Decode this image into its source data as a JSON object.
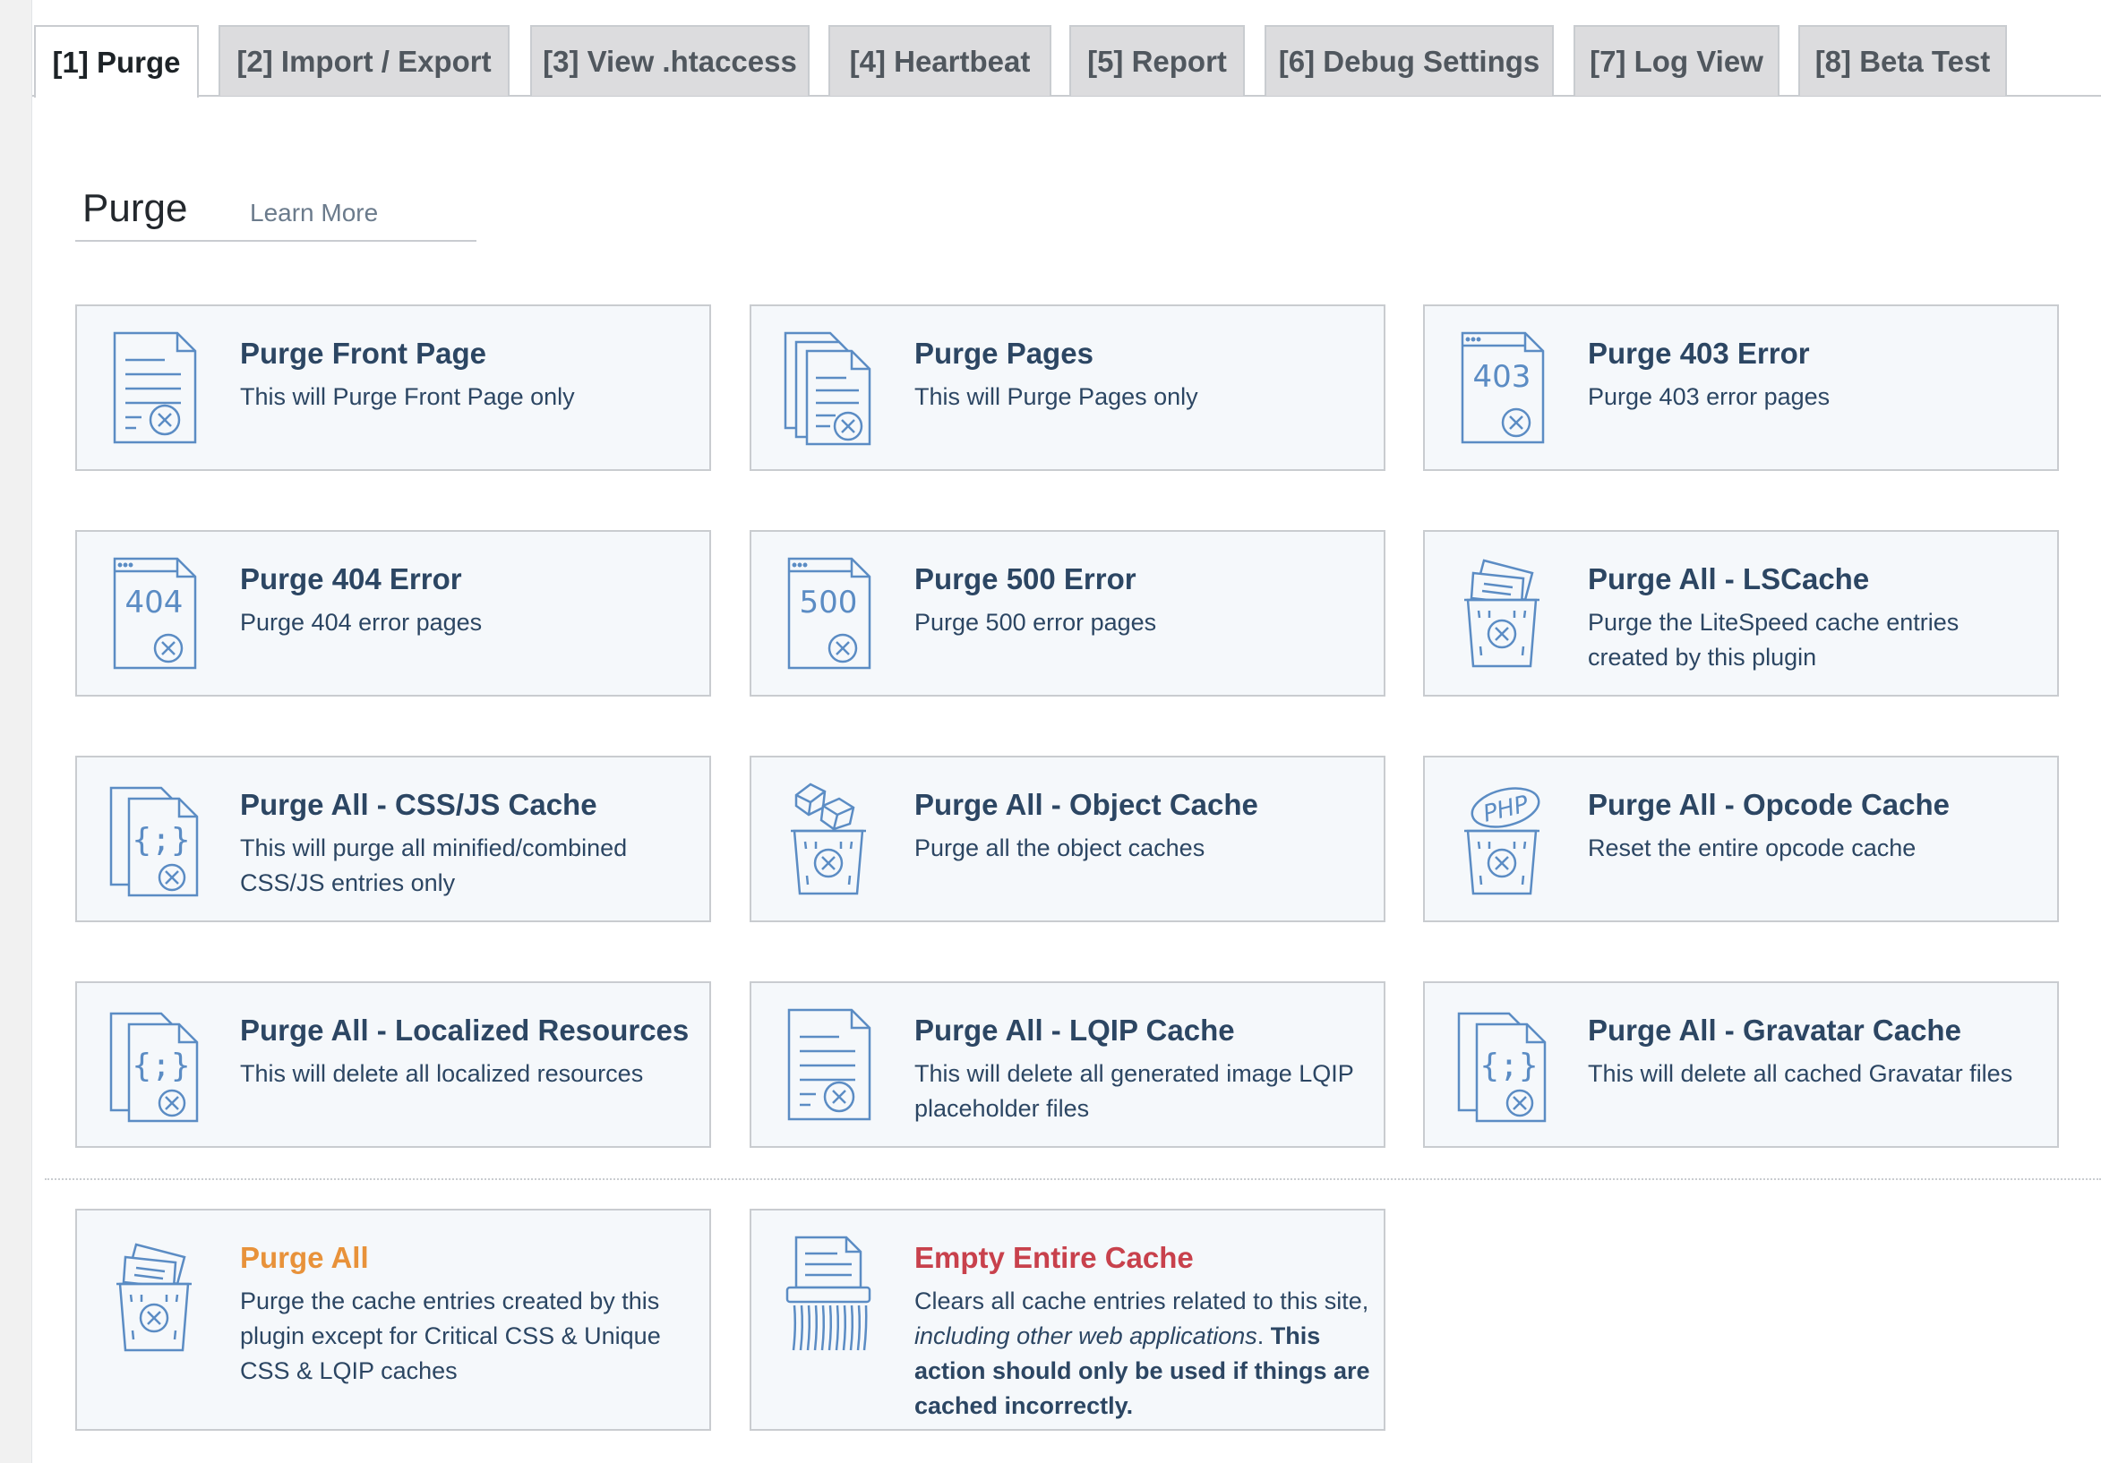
{
  "tabs": [
    {
      "label": "[1] Purge",
      "active": true
    },
    {
      "label": "[2] Import / Export",
      "active": false
    },
    {
      "label": "[3] View .htaccess",
      "active": false
    },
    {
      "label": "[4] Heartbeat",
      "active": false
    },
    {
      "label": "[5] Report",
      "active": false
    },
    {
      "label": "[6] Debug Settings",
      "active": false
    },
    {
      "label": "[7] Log View",
      "active": false
    },
    {
      "label": "[8] Beta Test",
      "active": false
    }
  ],
  "section": {
    "title": "Purge",
    "learn_more": "Learn More"
  },
  "cards": [
    {
      "title": "Purge Front Page",
      "desc": "This will Purge Front Page only",
      "icon": "document-purge-icon"
    },
    {
      "title": "Purge Pages",
      "desc": "This will Purge Pages only",
      "icon": "pages-purge-icon"
    },
    {
      "title": "Purge 403 Error",
      "desc": "Purge 403 error pages",
      "icon": "error-403-icon",
      "code": "403"
    },
    {
      "title": "Purge 404 Error",
      "desc": "Purge 404 error pages",
      "icon": "error-404-icon",
      "code": "404"
    },
    {
      "title": "Purge 500 Error",
      "desc": "Purge 500 error pages",
      "icon": "error-500-icon",
      "code": "500"
    },
    {
      "title": "Purge All - LSCache",
      "desc": "Purge the LiteSpeed cache entries created by this plugin",
      "icon": "trash-pages-icon"
    },
    {
      "title": "Purge All - CSS/JS Cache",
      "desc": "This will purge all minified/combined CSS/JS entries only",
      "icon": "code-files-icon"
    },
    {
      "title": "Purge All - Object Cache",
      "desc": "Purge all the object caches",
      "icon": "trash-cubes-icon"
    },
    {
      "title": "Purge All - Opcode Cache",
      "desc": "Reset the entire opcode cache",
      "icon": "trash-php-icon",
      "code": "PHP"
    },
    {
      "title": "Purge All - Localized Resources",
      "desc": "This will delete all localized resources",
      "icon": "code-files-icon"
    },
    {
      "title": "Purge All - LQIP Cache",
      "desc": "This will delete all generated image LQIP placeholder files",
      "icon": "document-purge-icon"
    },
    {
      "title": "Purge All - Gravatar Cache",
      "desc": "This will delete all cached Gravatar files",
      "icon": "code-files-icon"
    }
  ],
  "purge_all": {
    "title": "Purge All",
    "desc": "Purge the cache entries created by this plugin except for Critical CSS & Unique CSS & LQIP caches",
    "icon": "trash-pages-icon",
    "color": "#e8923a"
  },
  "empty_cache": {
    "title": "Empty Entire Cache",
    "desc_1": "Clears all cache entries related to this site, ",
    "desc_2": "including other web applications",
    "desc_3": ".",
    "desc_4": " This action should only be used if things are cached incorrectly.",
    "icon": "shredder-icon",
    "color": "#c8414c"
  },
  "colors": {
    "icon": "#5b8cc4",
    "card_bg": "#f5f8fb",
    "title": "#2c4663"
  }
}
